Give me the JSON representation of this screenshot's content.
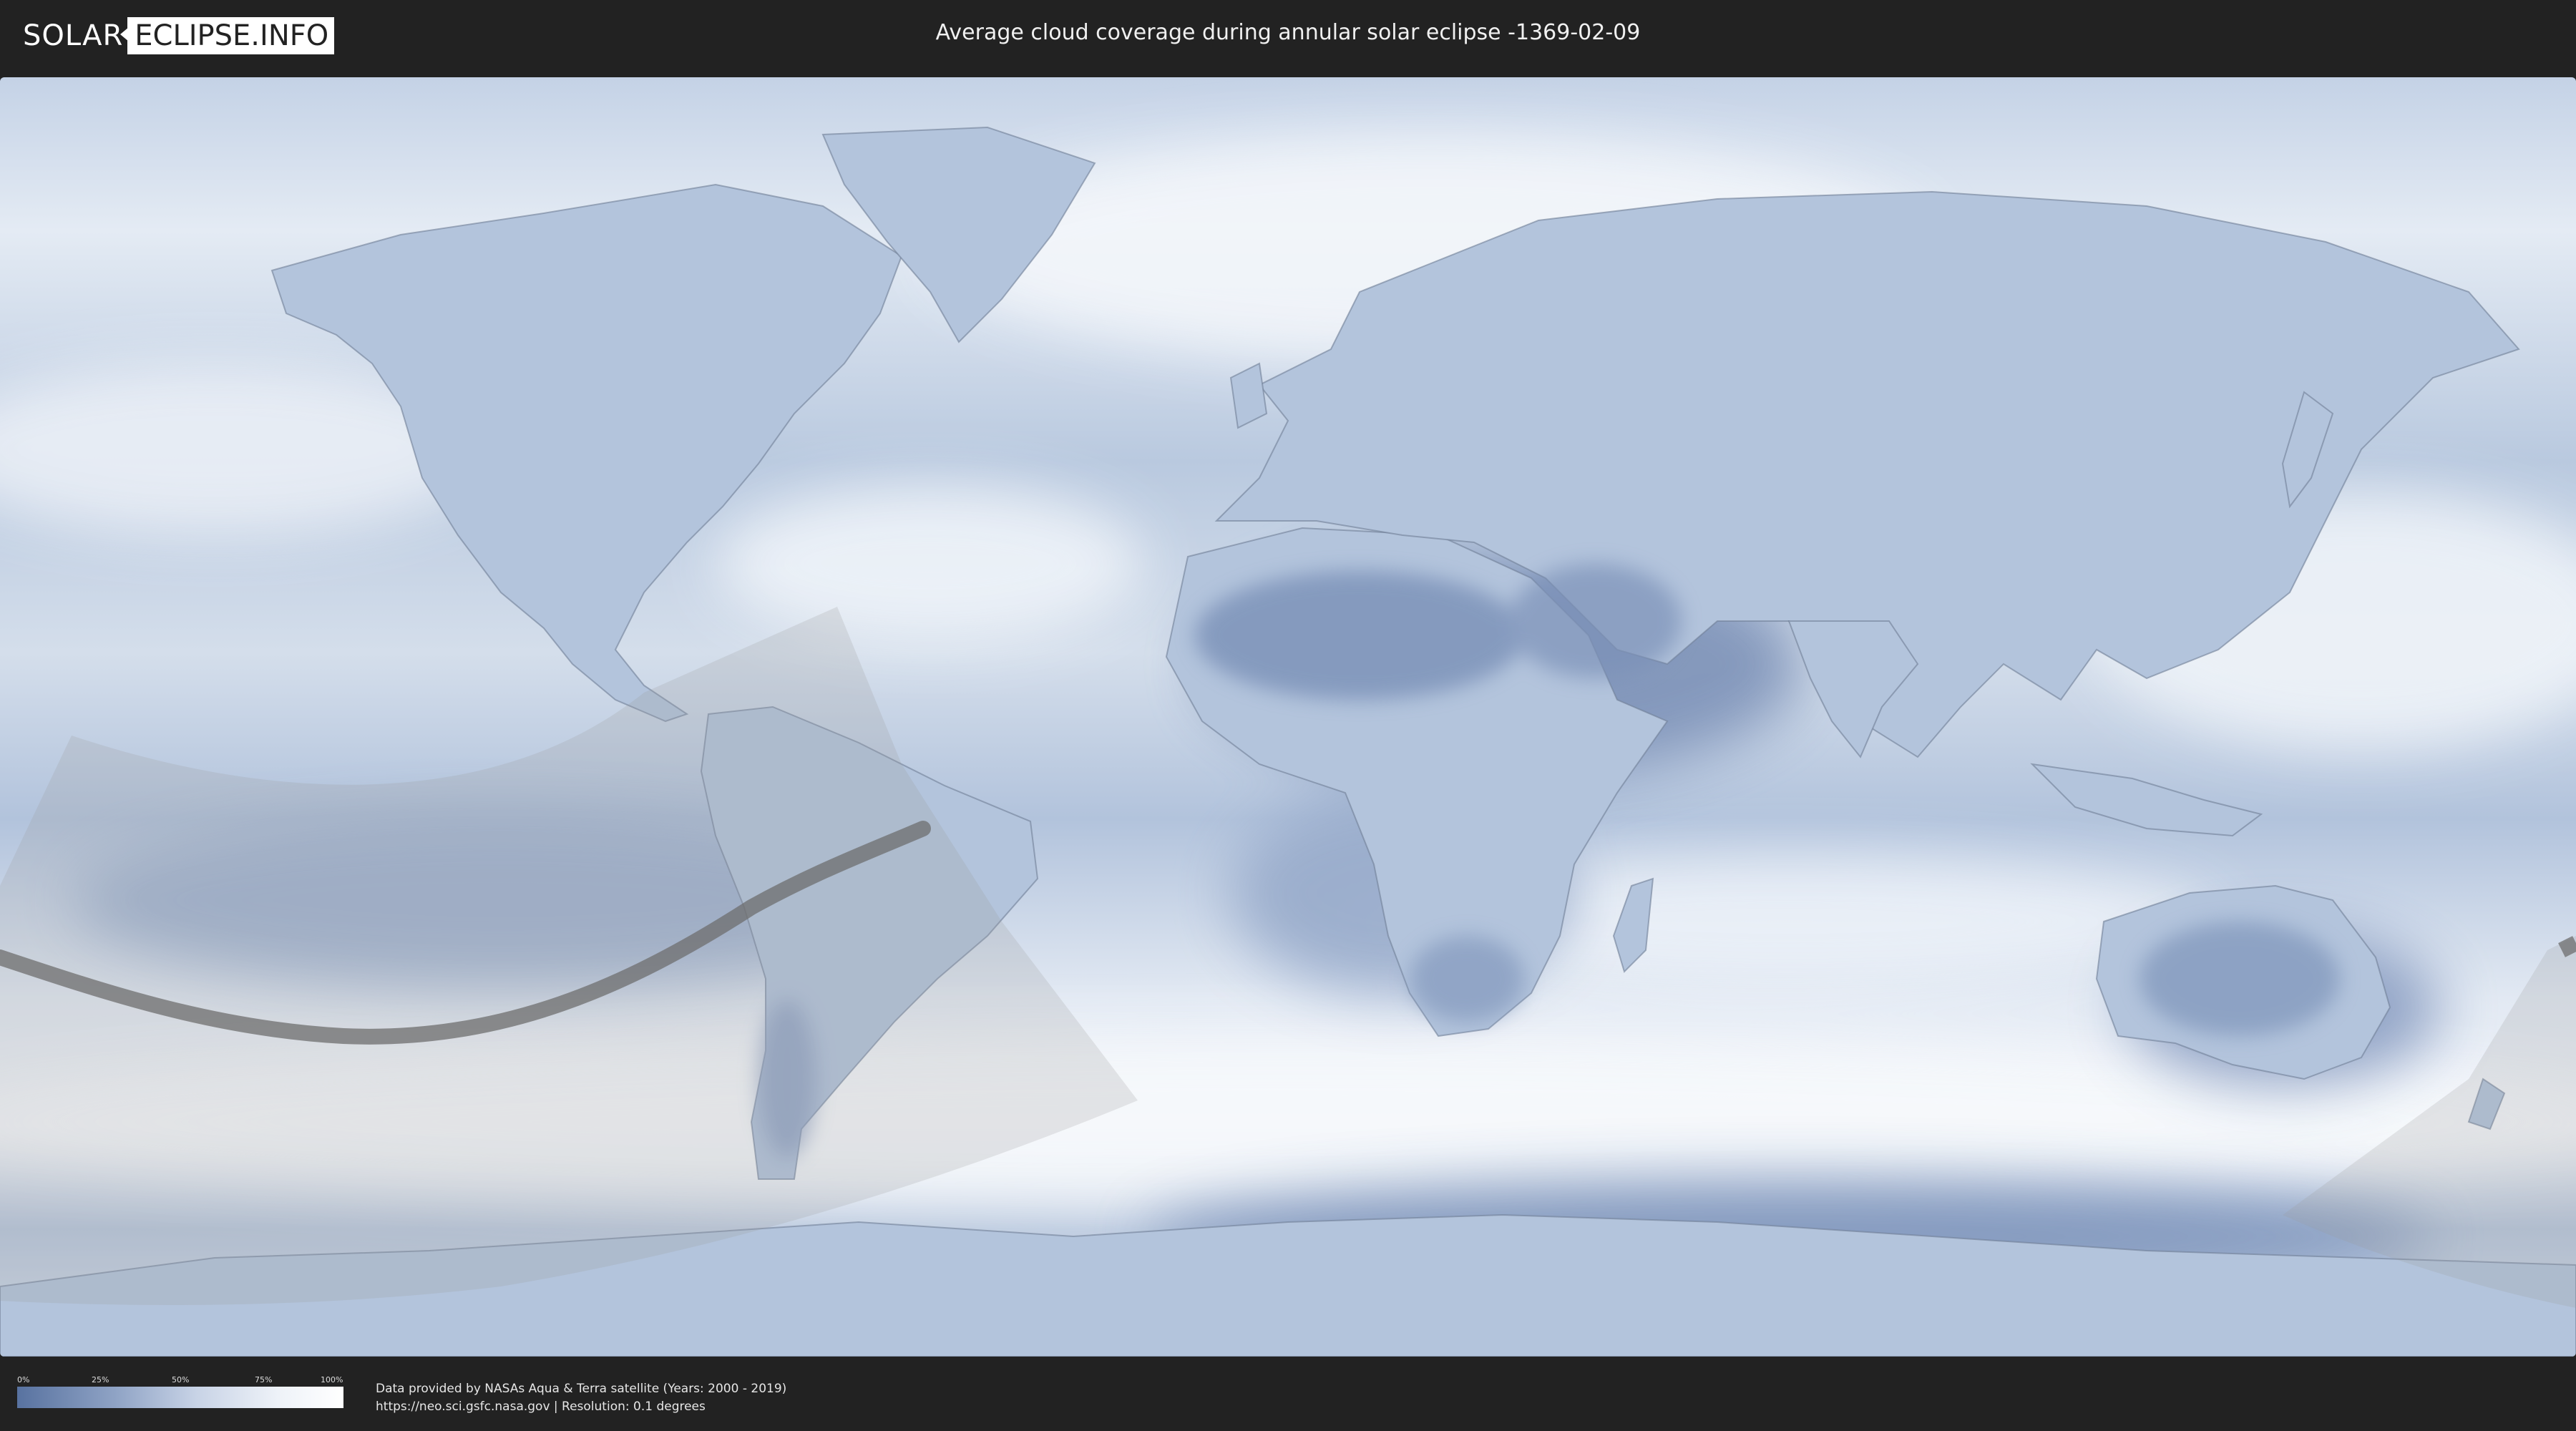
{
  "header": {
    "logo_left": "SOLAR",
    "logo_right": "ECLIPSE.INFO",
    "title": "Average cloud coverage during annular solar eclipse -1369-02-09"
  },
  "map": {
    "colors": {
      "clear_sky": "#5872a0",
      "cloud": "#ffffff",
      "coastline": "#6f7f96",
      "penumbra_shade": "#9a9a9a",
      "central_path": "#6e6e6e"
    }
  },
  "legend": {
    "ticks": [
      "0%",
      "25%",
      "50%",
      "75%",
      "100%"
    ],
    "gradient": [
      "#5872a0",
      "#8fa3c5",
      "#c8d3e6",
      "#eef2f8",
      "#ffffff"
    ]
  },
  "footer": {
    "credit_line1": "Data provided by NASAs Aqua & Terra satellite (Years: 2000 - 2019)",
    "credit_line2": "https://neo.sci.gsfc.nasa.gov | Resolution: 0.1 degrees"
  }
}
